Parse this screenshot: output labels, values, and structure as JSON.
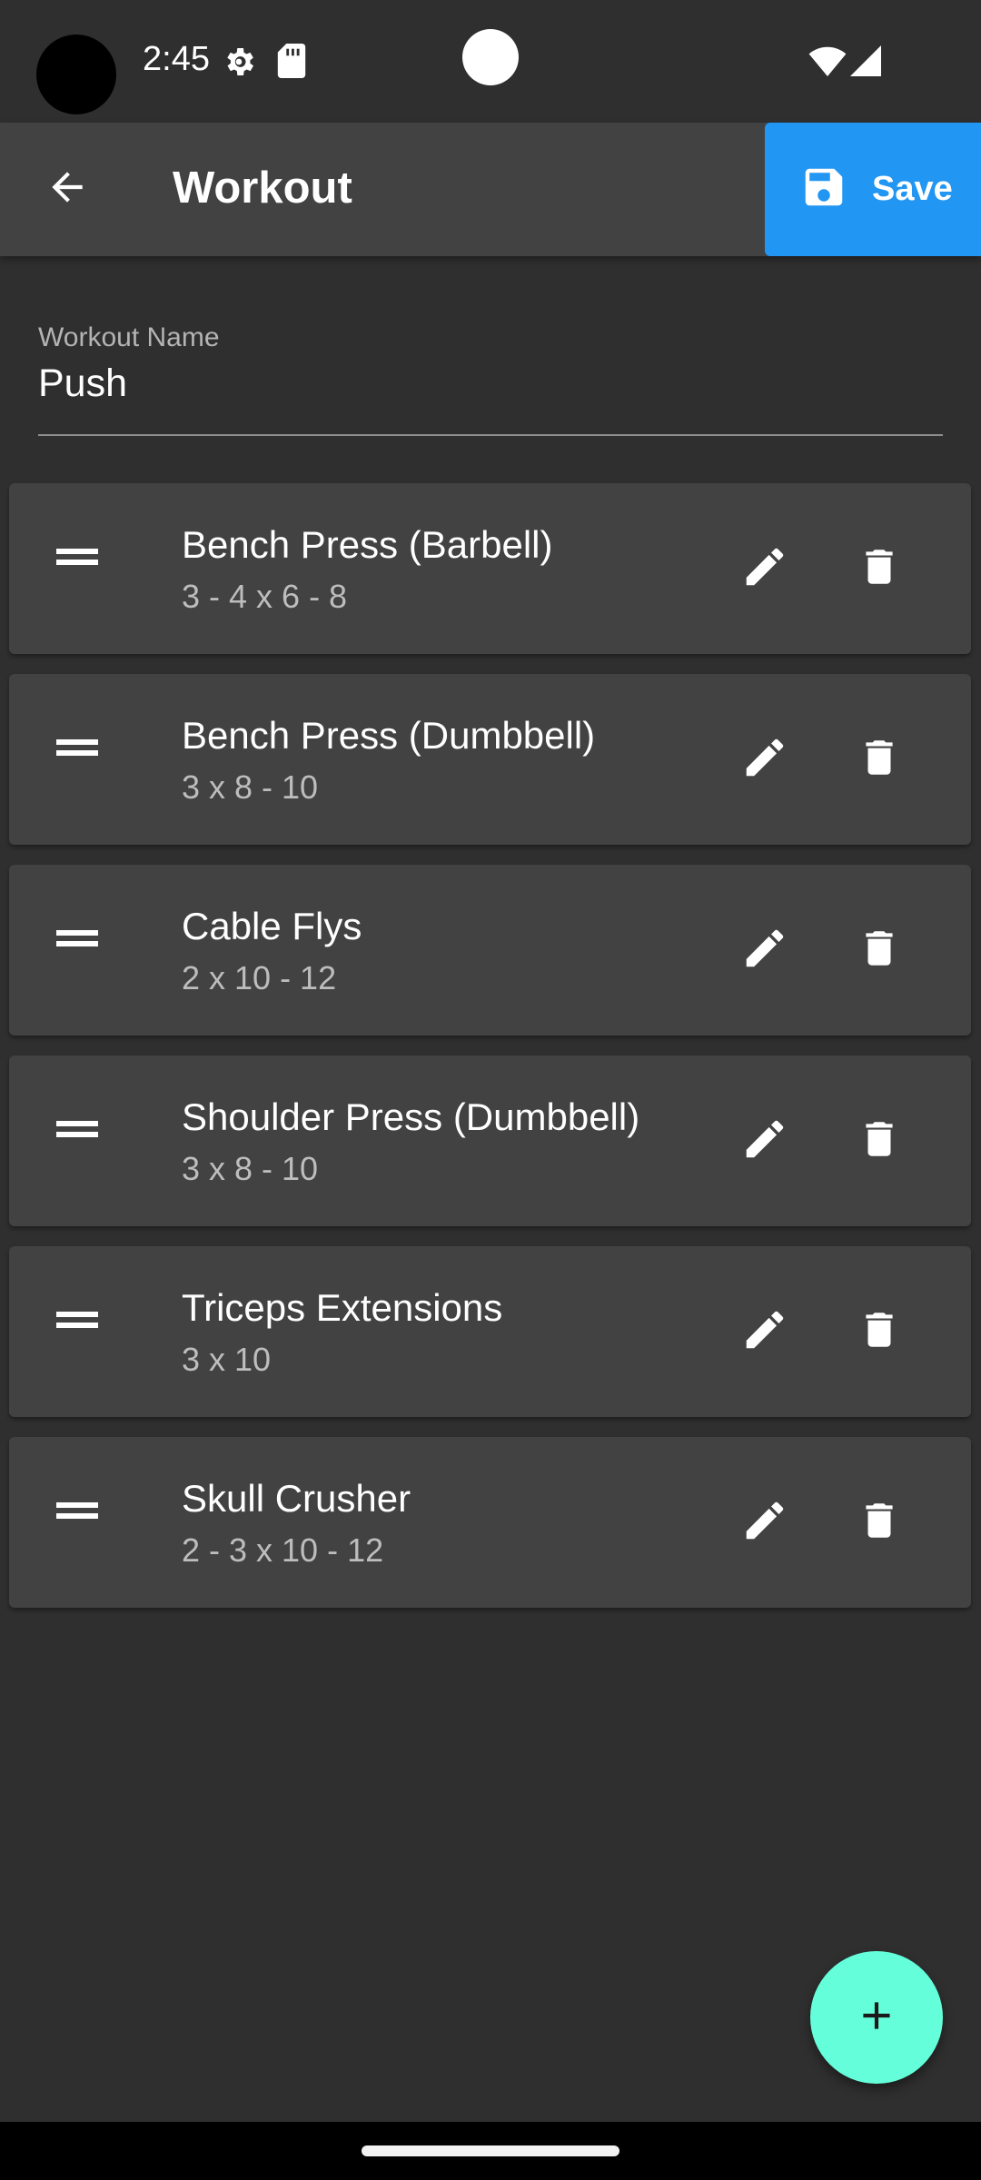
{
  "status_bar": {
    "time": "2:45",
    "icons": [
      "camera-dot",
      "settings-gear-icon",
      "sd-card-icon",
      "wifi-icon",
      "cellular-signal-icon"
    ]
  },
  "app_bar": {
    "title": "Workout",
    "back_icon": "arrow-left-icon",
    "save_label": "Save",
    "save_icon": "floppy-disk-icon"
  },
  "form": {
    "workout_name_label": "Workout Name",
    "workout_name_value": "Push"
  },
  "exercises": [
    {
      "name": "Bench Press (Barbell)",
      "sets": "3 - 4 x 6 - 8"
    },
    {
      "name": "Bench Press (Dumbbell)",
      "sets": "3 x 8 - 10"
    },
    {
      "name": "Cable Flys",
      "sets": "2 x 10 - 12"
    },
    {
      "name": "Shoulder Press (Dumbbell)",
      "sets": "3 x 8 - 10"
    },
    {
      "name": "Triceps Extensions",
      "sets": "3 x 10"
    },
    {
      "name": "Skull Crusher",
      "sets": "2 - 3 x 10 - 12"
    }
  ],
  "fab_icon": "plus-icon",
  "colors": {
    "background": "#2f2f2f",
    "app_bar": "#424242",
    "card": "#424242",
    "save_button": "#2196f3",
    "fab": "#64ffda"
  }
}
